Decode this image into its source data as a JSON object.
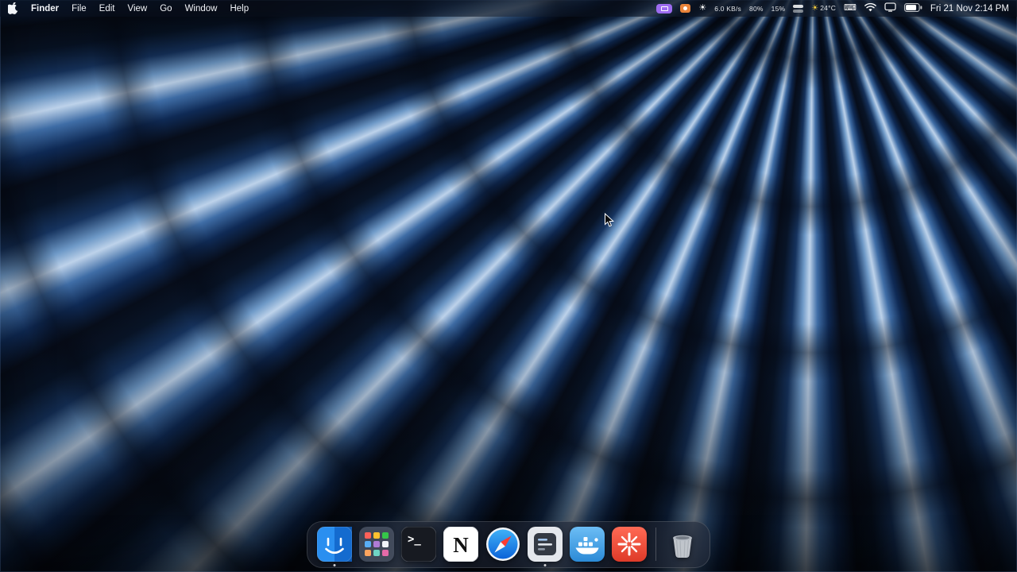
{
  "menu_bar": {
    "app_name": "Finder",
    "menus": [
      "File",
      "Edit",
      "View",
      "Go",
      "Window",
      "Help"
    ],
    "status": {
      "network_rate": "6.0 KB/s",
      "memory_usage": "80%",
      "cpu_usage": "15%",
      "temperature": "24°C",
      "clock": "Fri 21 Nov 2:14 PM"
    }
  },
  "dock": {
    "glyphs": {
      "terminal": ">_",
      "notion": "N"
    },
    "items": [
      {
        "id": "finder",
        "label": "Finder",
        "running": true
      },
      {
        "id": "launchpad",
        "label": "Launchpad",
        "running": false
      },
      {
        "id": "terminal",
        "label": "Terminal",
        "running": false
      },
      {
        "id": "notion",
        "label": "Notion",
        "running": false
      },
      {
        "id": "safari",
        "label": "Safari",
        "running": false
      },
      {
        "id": "editor",
        "label": "Editor",
        "running": true
      },
      {
        "id": "docker",
        "label": "Docker",
        "running": false
      },
      {
        "id": "asterisk-app",
        "label": "Asterisk App",
        "running": false
      },
      {
        "id": "trash",
        "label": "Trash",
        "running": false
      }
    ]
  },
  "colors": {
    "wallpaper_deep": "#070d1a",
    "wallpaper_mid": "#3f6da6",
    "wallpaper_light": "#bdd2ea",
    "menu_bar_bg": "rgba(12,18,32,0.45)",
    "dock_bg": "rgba(35,42,58,0.50)",
    "indicator_purple": "#9d6cf0",
    "indicator_orange": "#e8833a"
  }
}
